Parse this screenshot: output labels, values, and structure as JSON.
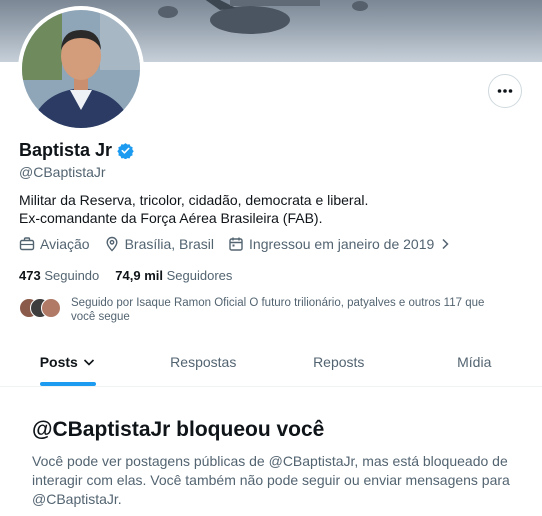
{
  "profile": {
    "name": "Baptista Jr",
    "handle": "@CBaptistaJr",
    "verified": true,
    "bio_line1": "Militar da Reserva, tricolor, cidadão, democrata e liberal.",
    "bio_line2": "Ex-comandante da Força Aérea Brasileira (FAB).",
    "category": "Aviação",
    "location": "Brasília, Brasil",
    "joined": "Ingressou em janeiro de 2019",
    "following_count": "473",
    "following_label": "Seguindo",
    "followers_count": "74,9 mil",
    "followers_label": "Seguidores",
    "followed_by_text": "Seguido por Isaque Ramon Oficial O futuro trilionário, patyalves e outros 117 que você segue"
  },
  "tabs": [
    {
      "label": "Posts",
      "active": true
    },
    {
      "label": "Respostas",
      "active": false
    },
    {
      "label": "Reposts",
      "active": false
    },
    {
      "label": "Mídia",
      "active": false
    }
  ],
  "blocked": {
    "title": "@CBaptistaJr bloqueou você",
    "message": "Você pode ver postagens públicas de @CBaptistaJr, mas está bloqueado de interagir com elas. Você também não pode seguir ou enviar mensagens para @CBaptistaJr."
  },
  "icons": {
    "more": "more-horizontal-icon",
    "verified": "verified-badge-icon",
    "category": "briefcase-icon",
    "location": "location-pin-icon",
    "calendar": "calendar-icon",
    "chevron": "chevron-right-icon",
    "tab_dropdown": "chevron-down-icon"
  },
  "colors": {
    "accent": "#1d9bf0",
    "text_primary": "#0f1419",
    "text_secondary": "#536471"
  }
}
